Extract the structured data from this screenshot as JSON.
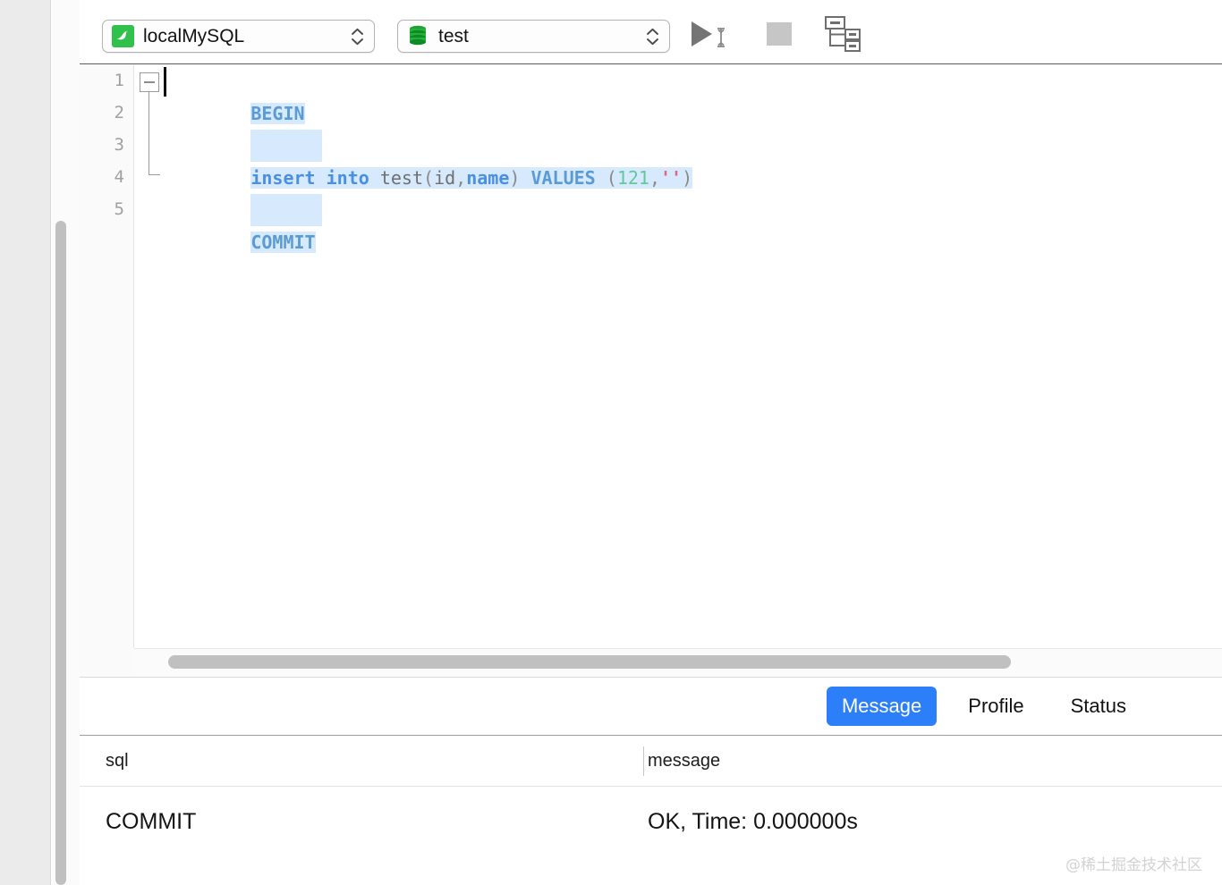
{
  "toolbar": {
    "connection": {
      "label": "localMySQL",
      "icon": "mysql-dolphin-icon"
    },
    "database": {
      "label": "test",
      "icon": "database-cylinder-icon"
    },
    "run_button": {
      "name": "run-query-button",
      "icon": "play-triangle-icon"
    },
    "stop_button": {
      "name": "stop-button",
      "icon": "stop-square-icon"
    },
    "explain_button": {
      "name": "explain-plan-button",
      "icon": "query-plan-tree-icon"
    }
  },
  "editor": {
    "line_numbers": [
      "1",
      "2",
      "3",
      "4",
      "5"
    ],
    "fold_marker": "collapse-minus-icon",
    "lines": [
      {
        "n": "1",
        "text": "BEGIN"
      },
      {
        "n": "2",
        "text": ""
      },
      {
        "n": "3",
        "text": "insert into test(id,name) VALUES (121,'')"
      },
      {
        "n": "4",
        "text": ""
      },
      {
        "n": "5",
        "text": "COMMIT"
      }
    ],
    "tokens_line3": {
      "insert": "insert",
      "into": "into",
      "table": "test",
      "paren_open": "(",
      "col_id": "id",
      "comma1": ",",
      "col_name": "name",
      "paren_close": ")",
      "values": "VALUES",
      "vparen_open": "(",
      "num": "121",
      "comma2": ",",
      "str": "''",
      "vparen_close": ")"
    }
  },
  "results": {
    "tabs": [
      {
        "label": "Message",
        "active": true
      },
      {
        "label": "Profile",
        "active": false
      },
      {
        "label": "Status",
        "active": false
      }
    ],
    "columns": [
      "sql",
      "message"
    ],
    "rows": [
      {
        "sql": "COMMIT",
        "message": "OK, Time: 0.000000s"
      }
    ]
  },
  "watermark": {
    "text": "@稀土掘金技术社区"
  },
  "colors": {
    "accent_blue": "#2d7ff9",
    "mysql_green": "#2fc14c",
    "selection": "#d7e9fd",
    "keyword_blue": "#4a90e2",
    "number_green": "#63c79a",
    "string_pink": "#e2657f"
  }
}
